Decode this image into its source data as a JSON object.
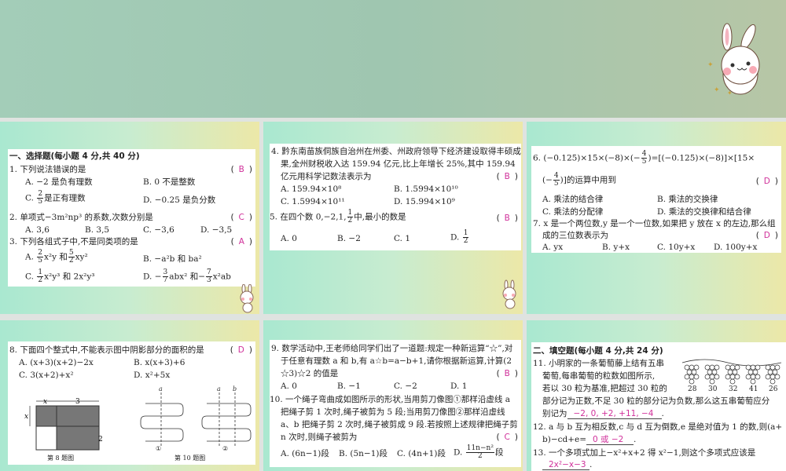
{
  "section1": {
    "title": "一、选择题(每小题 4 分,共 40 分)"
  },
  "q1": {
    "stem": "1. 下列说法错误的是",
    "answer": "B",
    "A": "A. −2 是负有理数",
    "B": "B. 0 不是整数",
    "C_pre": "C.",
    "C_num": "2",
    "C_den": "5",
    "C_post": "是正有理数",
    "D": "D. −0.25 是负分数"
  },
  "q2": {
    "stem": "2. 单项式−3m²np³ 的系数,次数分别是",
    "answer": "C",
    "A": "A. 3,6",
    "B": "B. 3,5",
    "C": "C. −3,6",
    "D": "D. −3,5"
  },
  "q3": {
    "stem": "3. 下列各组式子中,不是同类项的是",
    "answer": "A",
    "A_pre": "A.",
    "A_n1": "2",
    "A_d1": "5",
    "A_mid": "x²y 和",
    "A_n2": "5",
    "A_d2": "2",
    "A_post": "xy²",
    "B": "B. −a²b 和 ba²",
    "C_pre": "C.",
    "C_n": "1",
    "C_d": "2",
    "C_post": "x²y³ 和 2x²y³",
    "D_pre": "D. −",
    "D_n1": "3",
    "D_d1": "7",
    "D_mid": "abx² 和−",
    "D_n2": "7",
    "D_d2": "3",
    "D_post": "x²ab"
  },
  "q4": {
    "l1": "4. 黔东南苗族侗族自治州在州委、州政府领导下经济建设取得丰硕成",
    "l2": "果,全州财税收入达 159.94 亿元,比上年增长 25%,其中 159.94",
    "l3": "亿元用科学记数法表示为",
    "answer": "B",
    "A": "A. 159.94×10⁸",
    "B": "B. 1.5994×10¹⁰",
    "C": "C. 1.5994×10¹¹",
    "D": "D. 15.994×10⁹"
  },
  "q5": {
    "pre": "5. 在四个数 0,−2,1,",
    "n": "1",
    "d": "2",
    "post": "中,最小的数是",
    "answer": "B",
    "A": "A. 0",
    "B": "B. −2",
    "C": "C. 1",
    "D_pre": "D.",
    "D_n": "1",
    "D_d": "2"
  },
  "q6": {
    "l1_pre": "6. (−0.125)×15×(−8)×(−",
    "n": "4",
    "d": "5",
    "l1_post": ")=[(−0.125)×(−8)]×[15×",
    "l2_pre": "(−",
    "l2_post": ")]的运算中用到",
    "answer": "D",
    "A": "A. 乘法的结合律",
    "B": "B. 乘法的交换律",
    "C": "C. 乘法的分配律",
    "D": "D. 乘法的交换律和结合律"
  },
  "q7": {
    "l1": "7. x 是一个两位数,y 是一个一位数,如果把 y 放在 x 的左边,那么组",
    "l2": "成的三位数表示为",
    "answer": "D",
    "A": "A. yx",
    "B": "B. y+x",
    "C": "C. 10y+x",
    "D": "D. 100y+x"
  },
  "q8": {
    "stem": "8. 下面四个整式中,不能表示图中阴影部分的面积的是",
    "answer": "D",
    "A": "A. (x+3)(x+2)−2x",
    "B": "B. x(x+3)+6",
    "C": "C. 3(x+2)+x²",
    "D": "D. x²+5x"
  },
  "fig8": {
    "caption": "第 8 题图",
    "x": "x",
    "three": "3",
    "two": "2"
  },
  "fig10": {
    "caption": "第 10 题图",
    "a": "a",
    "b": "b",
    "m1": "①",
    "m2": "②"
  },
  "q9": {
    "l1": "9. 数学活动中,王老师给同学们出了一道题:规定一种新运算“☆”,对",
    "l2": "于任意有理数 a 和 b,有 a☆b=a−b+1,请你根据新运算,计算(2",
    "l3": "☆3)☆2 的值是",
    "answer": "B",
    "A": "A. 0",
    "B": "B. −1",
    "C": "C. −2",
    "D": "D. 1"
  },
  "q10": {
    "l1": "10. 一个绳子弯曲成如图所示的形状,当用剪刀像图①那样沿虚线 a",
    "l2": "把绳子剪 1 次时,绳子被剪为 5 段;当用剪刀像图②那样沿虚线",
    "l3": "a、b 把绳子剪 2 次时,绳子被剪成 9 段.若按照上述规律把绳子剪",
    "l4": "n 次时,则绳子被剪为",
    "answer": "C",
    "A": "A. (6n−1)段",
    "B": "B. (5n−1)段",
    "C": "C. (4n+1)段",
    "D_pre": "D.",
    "D_n": "11n−n²",
    "D_d": "2",
    "D_post": "段"
  },
  "section2": {
    "title": "二、填空题(每小题 4 分,共 24 分)"
  },
  "q11": {
    "l1": "11. 小明家的一条葡萄藤上结有五串",
    "l2": "葡萄,每串葡萄的粒数如图所示,",
    "l3": "若以 30 粒为基准,把超过 30 粒的",
    "l4": "部分记为正数,不足 30 粒的部分记为负数,那么这五串葡萄应分",
    "l5": "别记为",
    "fill": "−2, 0, +2, +11, −4",
    "grapes": [
      "28",
      "30",
      "32",
      "41",
      "26"
    ]
  },
  "q12": {
    "l1": "12. a 与 b 互为相反数,c 与 d 互为倒数,e 是绝对值为 1 的数,则(a+",
    "l2": "b)−cd+e=",
    "fill": "0 或 −2"
  },
  "q13": {
    "l1": "13. 一个多项式加上−x²+x+2 得 x²−1,则这个多项式应该是",
    "fill": "2x²−x−3"
  },
  "punct": "."
}
